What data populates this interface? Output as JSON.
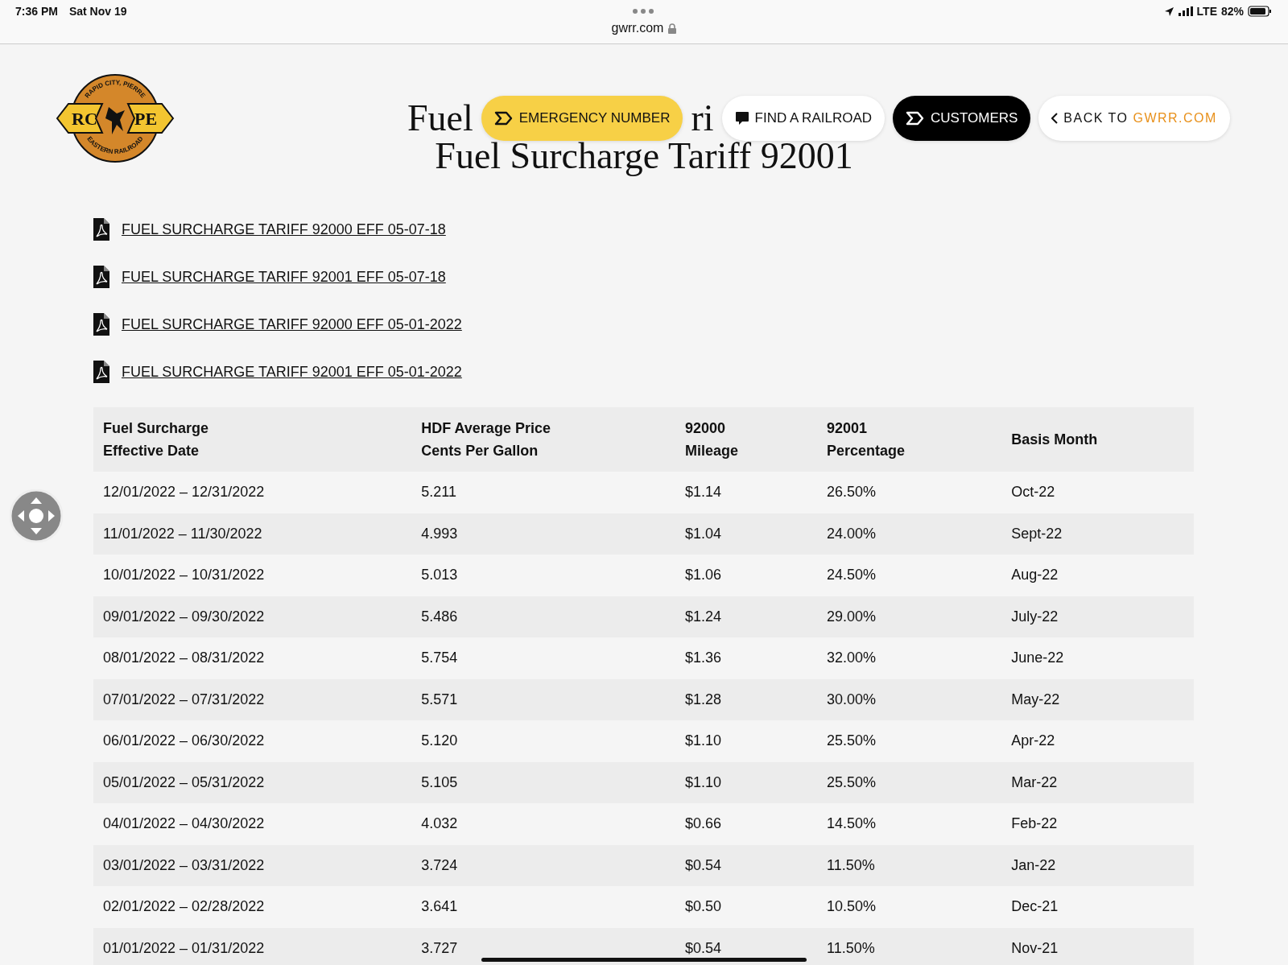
{
  "status_bar": {
    "time": "7:36 PM",
    "date": "Sat Nov 19",
    "url": "gwrr.com",
    "network": "LTE",
    "battery": "82%"
  },
  "logo": {
    "top_text": "RAPID CITY, PIERRE",
    "bottom_text": "EASTERN RAILROAD",
    "left": "RC",
    "right": "PE"
  },
  "nav": [
    {
      "kind": "yellow",
      "label": "EMERGENCY NUMBER"
    },
    {
      "kind": "white",
      "label": "FIND A RAILROAD"
    },
    {
      "kind": "black",
      "label": "CUSTOMERS"
    },
    {
      "kind": "back",
      "label": "BACK TO ",
      "accent": "GWRR.COM"
    }
  ],
  "title": {
    "line_1_fragments": [
      "Fuel",
      "ri"
    ],
    "line_2": "Fuel Surcharge Tariff 92001"
  },
  "documents": [
    "FUEL SURCHARGE TARIFF 92000 EFF 05-07-18",
    "FUEL SURCHARGE TARIFF 92001 EFF 05-07-18",
    "FUEL SURCHARGE TARIFF 92000 EFF 05-01-2022",
    "FUEL SURCHARGE TARIFF 92001 EFF 05-01-2022"
  ],
  "table": {
    "columns": [
      "Fuel Surcharge\nEffective Date",
      "HDF Average Price\nCents Per Gallon",
      "92000\nMileage",
      "92001\nPercentage",
      "Basis Month"
    ],
    "rows": [
      [
        "12/01/2022 – 12/31/2022",
        "5.211",
        "$1.14",
        "26.50%",
        "Oct-22"
      ],
      [
        "11/01/2022 – 11/30/2022",
        "4.993",
        "$1.04",
        "24.00%",
        "Sept-22"
      ],
      [
        "10/01/2022 – 10/31/2022",
        "5.013",
        "$1.06",
        "24.50%",
        "Aug-22"
      ],
      [
        "09/01/2022 – 09/30/2022",
        "5.486",
        "$1.24",
        "29.00%",
        "July-22"
      ],
      [
        "08/01/2022 – 08/31/2022",
        "5.754",
        "$1.36",
        "32.00%",
        "June-22"
      ],
      [
        "07/01/2022 – 07/31/2022",
        "5.571",
        "$1.28",
        "30.00%",
        "May-22"
      ],
      [
        "06/01/2022 – 06/30/2022",
        "5.120",
        "$1.10",
        "25.50%",
        "Apr-22"
      ],
      [
        "05/01/2022 – 05/31/2022",
        "5.105",
        "$1.10",
        "25.50%",
        "Mar-22"
      ],
      [
        "04/01/2022 – 04/30/2022",
        "4.032",
        "$0.66",
        "14.50%",
        "Feb-22"
      ],
      [
        "03/01/2022 – 03/31/2022",
        "3.724",
        "$0.54",
        "11.50%",
        "Jan-22"
      ],
      [
        "02/01/2022 – 02/28/2022",
        "3.641",
        "$0.50",
        "10.50%",
        "Dec-21"
      ],
      [
        "01/01/2022 – 01/31/2022",
        "3.727",
        "$0.54",
        "11.50%",
        "Nov-21"
      ]
    ]
  }
}
